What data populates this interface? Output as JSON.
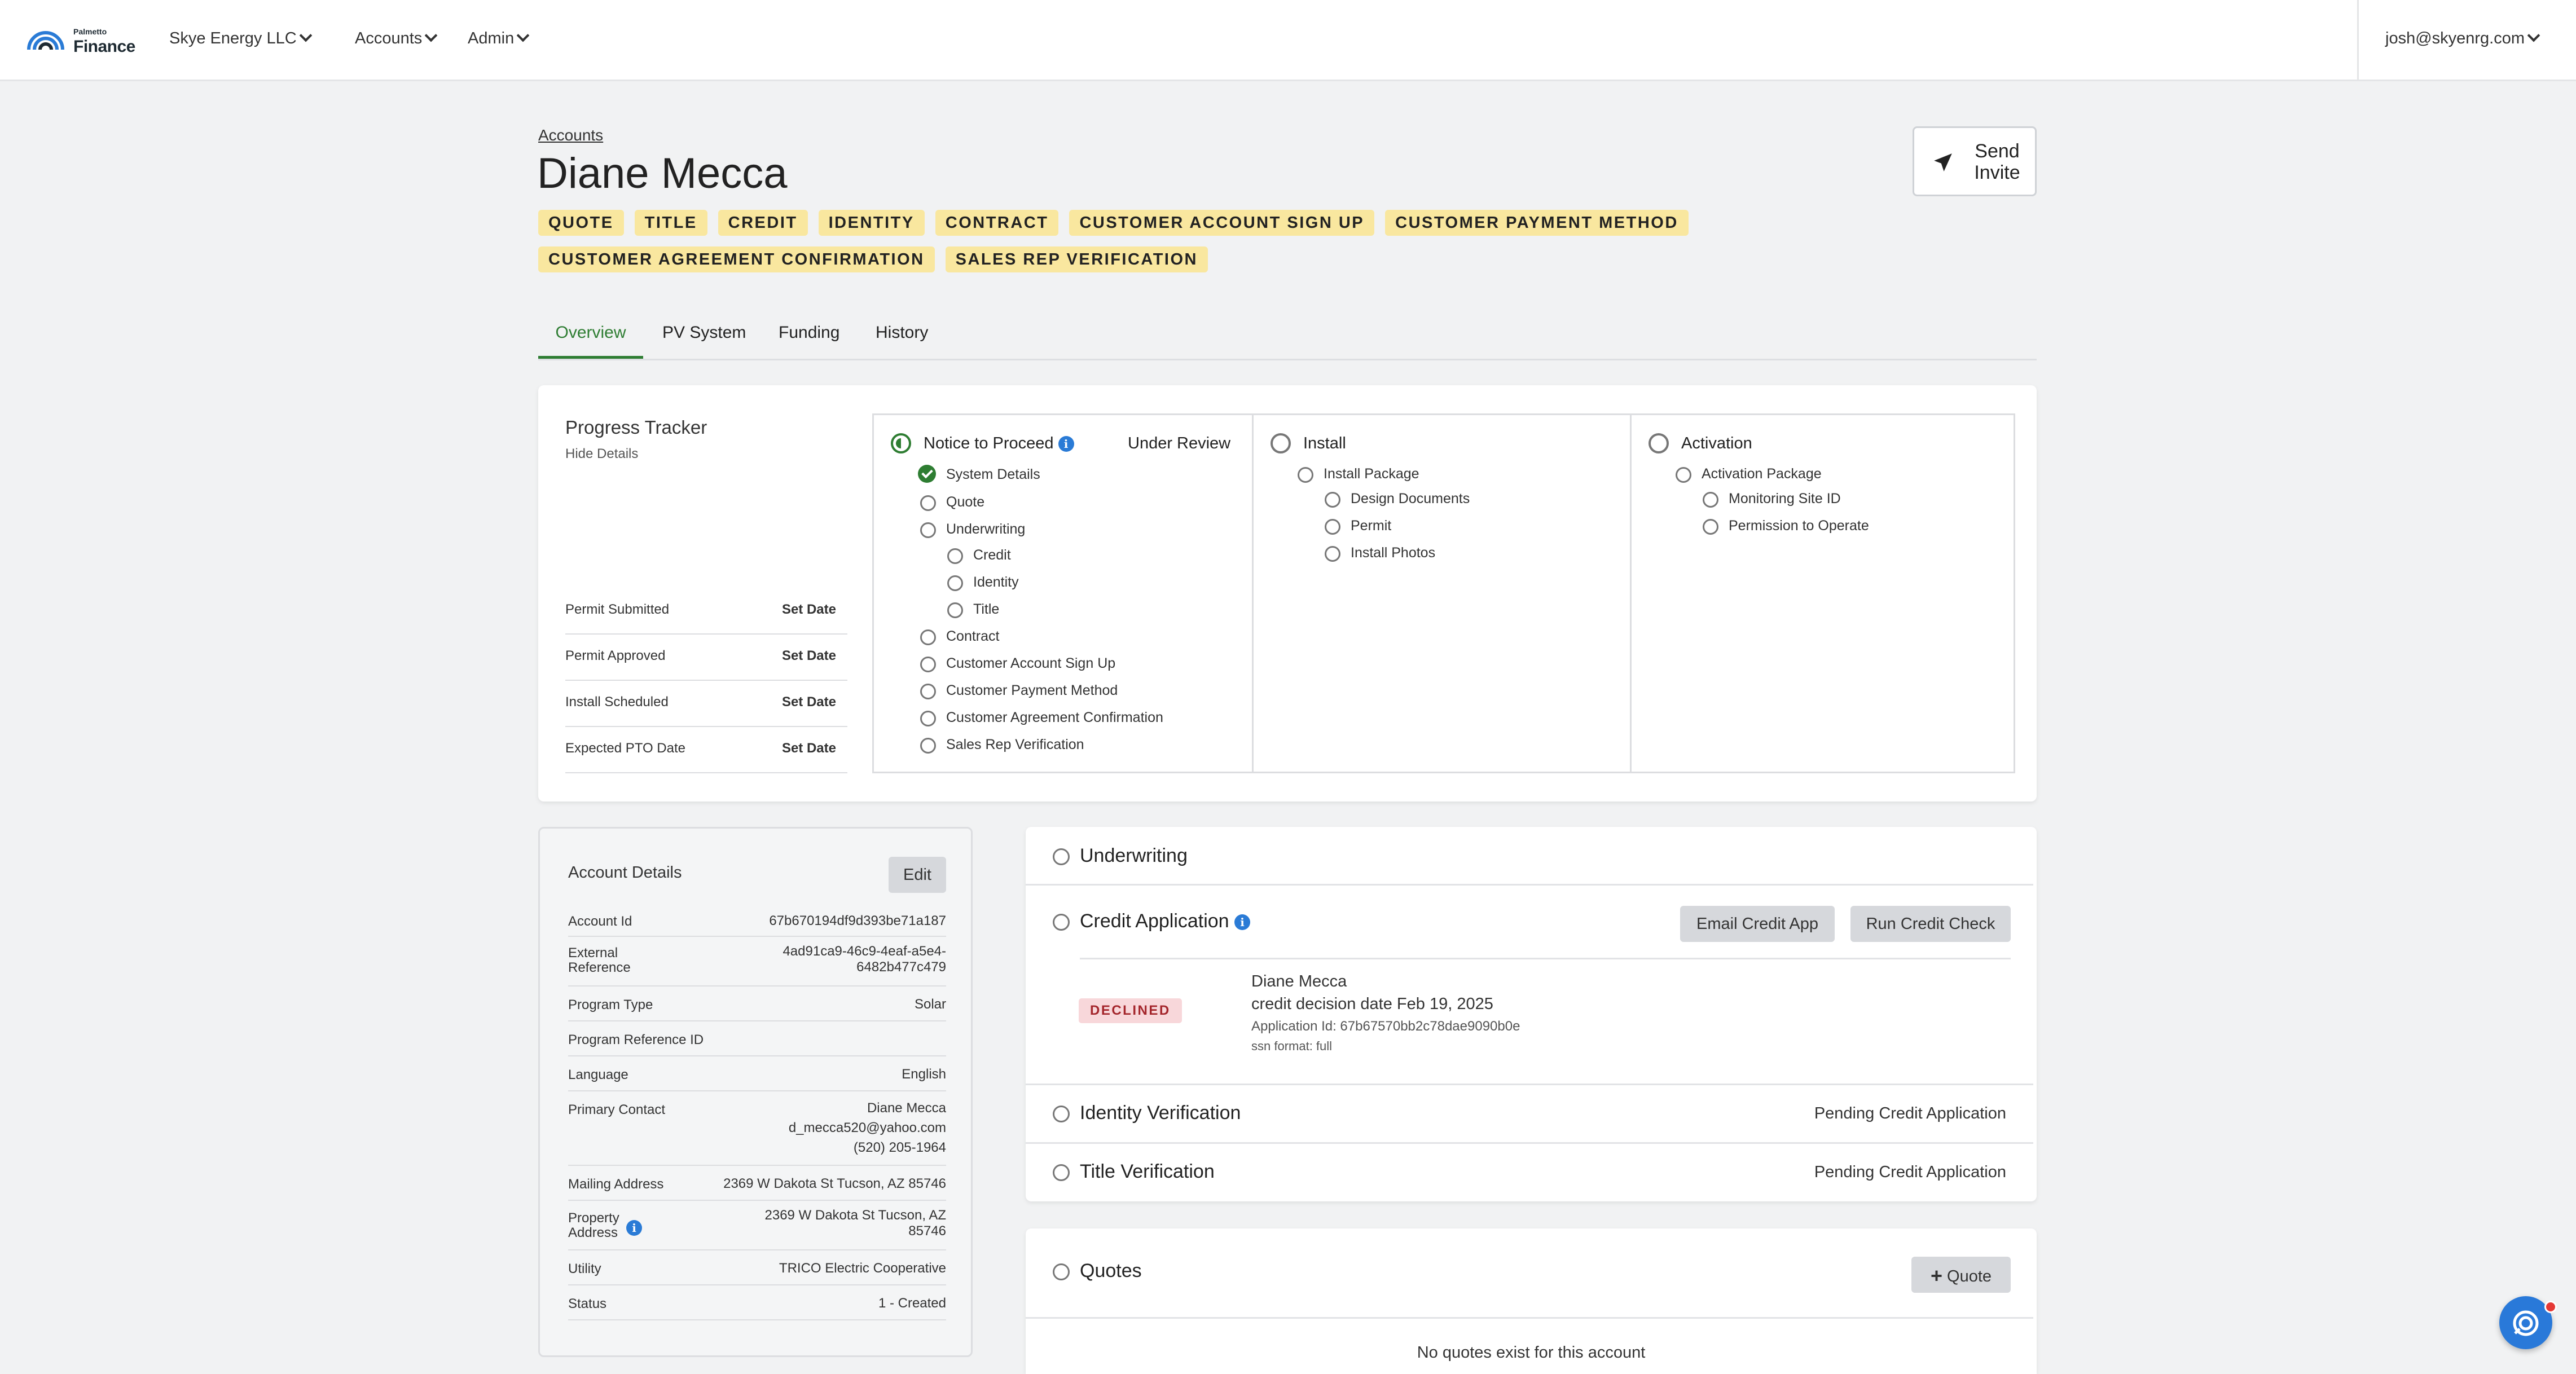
{
  "nav": {
    "logo_small": "Palmetto",
    "logo_big": "Finance",
    "org": "Skye Energy LLC",
    "accounts": "Accounts",
    "admin": "Admin",
    "user": "josh@skyenrg.com"
  },
  "header": {
    "breadcrumb": "Accounts",
    "name": "Diane Mecca",
    "send_invite": "Send Invite",
    "tags": [
      "QUOTE",
      "TITLE",
      "CREDIT",
      "IDENTITY",
      "CONTRACT",
      "CUSTOMER ACCOUNT SIGN UP",
      "CUSTOMER PAYMENT METHOD",
      "CUSTOMER AGREEMENT CONFIRMATION",
      "SALES REP VERIFICATION"
    ]
  },
  "tabs": [
    "Overview",
    "PV System",
    "Funding",
    "History"
  ],
  "progress": {
    "title": "Progress Tracker",
    "hide": "Hide Details",
    "dates": [
      {
        "label": "Permit Submitted",
        "action": "Set Date"
      },
      {
        "label": "Permit Approved",
        "action": "Set Date"
      },
      {
        "label": "Install Scheduled",
        "action": "Set Date"
      },
      {
        "label": "Expected PTO Date",
        "action": "Set Date"
      }
    ],
    "ntp": {
      "title": "Notice to Proceed",
      "status": "Under Review",
      "items": [
        "System Details",
        "Quote",
        "Underwriting",
        "Credit",
        "Identity",
        "Title",
        "Contract",
        "Customer Account Sign Up",
        "Customer Payment Method",
        "Customer Agreement Confirmation",
        "Sales Rep Verification"
      ]
    },
    "install": {
      "title": "Install",
      "items": [
        "Install Package",
        "Design Documents",
        "Permit",
        "Install Photos"
      ]
    },
    "activation": {
      "title": "Activation",
      "items": [
        "Activation Package",
        "Monitoring Site ID",
        "Permission to Operate"
      ]
    }
  },
  "account": {
    "title": "Account Details",
    "edit": "Edit",
    "rows": {
      "account_id_k": "Account Id",
      "account_id_v": "67b670194df9d393be71a187",
      "ext_k": "External Reference",
      "ext_v": "4ad91ca9-46c9-4eaf-a5e4-6482b477c479",
      "prog_k": "Program Type",
      "prog_v": "Solar",
      "progref_k": "Program Reference ID",
      "progref_v": "",
      "lang_k": "Language",
      "lang_v": "English",
      "contact_k": "Primary Contact",
      "contact_name": "Diane Mecca",
      "contact_email": "d_mecca520@yahoo.com",
      "contact_phone": "(520) 205-1964",
      "mail_k": "Mailing Address",
      "mail_v": "2369 W Dakota St Tucson, AZ 85746",
      "prop_k": "Property Address",
      "prop_v": "2369 W Dakota St Tucson, AZ 85746",
      "util_k": "Utility",
      "util_v": "TRICO Electric Cooperative",
      "status_k": "Status",
      "status_v": "1 - Created"
    }
  },
  "underwriting": {
    "title": "Underwriting",
    "credit_title": "Credit Application",
    "email_btn": "Email Credit App",
    "run_btn": "Run Credit Check",
    "badge": "DECLINED",
    "applicant": "Diane Mecca",
    "decision": "credit decision date Feb 19, 2025",
    "app_id": "Application Id: 67b67570bb2c78dae9090b0e",
    "ssn": "ssn format: full",
    "identity_title": "Identity Verification",
    "identity_status": "Pending Credit Application",
    "title_title": "Title Verification",
    "title_status": "Pending Credit Application"
  },
  "quotes": {
    "title": "Quotes",
    "add_btn": "Quote",
    "empty": "No quotes exist for this account"
  },
  "colors": {
    "accent": "#2e7d32",
    "tag": "#f9e79f",
    "declined_bg": "#f8d7da",
    "declined_text": "#a4262c",
    "info": "#2a7bd6"
  }
}
